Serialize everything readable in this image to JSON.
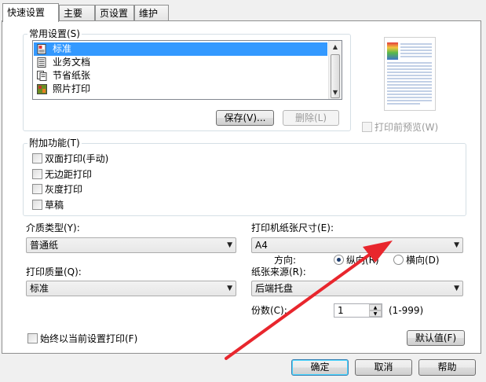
{
  "tabs": [
    {
      "label": "快速设置",
      "active": true
    },
    {
      "label": "主要",
      "active": false
    },
    {
      "label": "页设置",
      "active": false
    },
    {
      "label": "维护",
      "active": false
    }
  ],
  "common_settings": {
    "legend": "常用设置(S)",
    "items": [
      {
        "label": "标准",
        "icon": "standard-doc-icon",
        "selected": true
      },
      {
        "label": "业务文档",
        "icon": "business-doc-icon",
        "selected": false
      },
      {
        "label": "节省纸张",
        "icon": "save-paper-icon",
        "selected": false
      },
      {
        "label": "照片打印",
        "icon": "photo-print-icon",
        "selected": false
      }
    ],
    "save_button": "保存(V)...",
    "delete_button": "删除(L)"
  },
  "preview": {
    "checkbox_label": "打印前预览(W)",
    "checked": false
  },
  "additional": {
    "legend": "附加功能(T)",
    "options": [
      {
        "label": "双面打印(手动)",
        "checked": false
      },
      {
        "label": "无边距打印",
        "checked": false
      },
      {
        "label": "灰度打印",
        "checked": false
      },
      {
        "label": "草稿",
        "checked": false
      }
    ]
  },
  "media_type": {
    "label": "介质类型(Y):",
    "value": "普通纸"
  },
  "paper_size": {
    "label": "打印机纸张尺寸(E):",
    "value": "A4"
  },
  "orientation": {
    "label": "方向:",
    "portrait": "纵向(R)",
    "landscape": "横向(D)",
    "selected": "portrait"
  },
  "print_quality": {
    "label": "打印质量(Q):",
    "value": "标准"
  },
  "paper_source": {
    "label": "纸张来源(R):",
    "value": "后端托盘"
  },
  "copies": {
    "label": "份数(C):",
    "value": "1",
    "range": "(1-999)"
  },
  "always_print": {
    "label": "始终以当前设置打印(F)",
    "checked": false
  },
  "defaults_button": "默认值(F)",
  "footer": {
    "ok": "确定",
    "cancel": "取消",
    "help": "帮助"
  },
  "colors": {
    "selection": "#3399ff",
    "annotation_arrow": "#e8262d"
  }
}
